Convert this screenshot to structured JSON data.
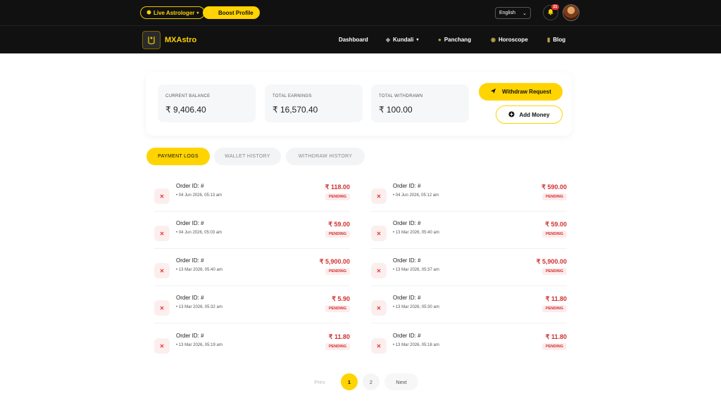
{
  "topbar": {
    "live_label": "Live Astrologer",
    "boost_label": "Boost Profile",
    "language": "English",
    "notification_count": "21"
  },
  "nav": {
    "brand": "MXAstro",
    "items": [
      "Dashboard",
      "Kundali",
      "Panchang",
      "Horoscope",
      "Blog"
    ]
  },
  "summary": {
    "current_balance_label": "CURRENT BALANCE",
    "current_balance": "₹ 9,406.40",
    "total_earnings_label": "TOTAL EARNINGS",
    "total_earnings": "₹ 16,570.40",
    "total_withdrawn_label": "TOTAL WITHDRAWN",
    "total_withdrawn": "₹ 100.00",
    "withdraw_button": "Withdraw Request",
    "add_money_button": "Add Money"
  },
  "tabs": [
    {
      "label": "PAYMENT LOGS",
      "active": true
    },
    {
      "label": "WALLET HISTORY",
      "active": false
    },
    {
      "label": "WITHDRAW HISTORY",
      "active": false
    }
  ],
  "logs": [
    {
      "order": "Order ID: #",
      "date": "04 Jun 2026, 05:13 am",
      "amount": "₹ 118.00",
      "status": "PENDING"
    },
    {
      "order": "Order ID: #",
      "date": "04 Jun 2026, 05:12 am",
      "amount": "₹ 590.00",
      "status": "PENDING"
    },
    {
      "order": "Order ID: #",
      "date": "04 Jun 2026, 05:03 am",
      "amount": "₹ 59.00",
      "status": "PENDING"
    },
    {
      "order": "Order ID: #",
      "date": "13 Mar 2026, 05:40 am",
      "amount": "₹ 59.00",
      "status": "PENDING"
    },
    {
      "order": "Order ID: #",
      "date": "13 Mar 2026, 05:40 am",
      "amount": "₹ 5,900.00",
      "status": "PENDING"
    },
    {
      "order": "Order ID: #",
      "date": "13 Mar 2026, 05:37 am",
      "amount": "₹ 5,900.00",
      "status": "PENDING"
    },
    {
      "order": "Order ID: #",
      "date": "13 Mar 2026, 05:32 am",
      "amount": "₹ 5.90",
      "status": "PENDING"
    },
    {
      "order": "Order ID: #",
      "date": "13 Mar 2026, 05:30 am",
      "amount": "₹ 11.80",
      "status": "PENDING"
    },
    {
      "order": "Order ID: #",
      "date": "13 Mar 2026, 05:19 am",
      "amount": "₹ 11.80",
      "status": "PENDING"
    },
    {
      "order": "Order ID: #",
      "date": "13 Mar 2026, 05:18 am",
      "amount": "₹ 11.80",
      "status": "PENDING"
    }
  ],
  "pagination": {
    "prev": "Prev",
    "pages": [
      "1",
      "2"
    ],
    "next": "Next"
  },
  "colors": {
    "accent": "#ffd400",
    "header_bg": "#111111",
    "pending_red": "#d32f2f"
  }
}
